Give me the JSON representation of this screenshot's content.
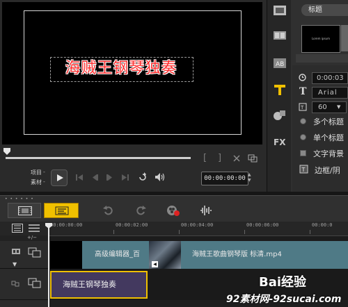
{
  "preview": {
    "title_overlay": "海贼王钢琴独奏",
    "project_label": "项目",
    "clip_label": "素材",
    "timecode": "00:00:00:00",
    "trim_brackets": [
      "[",
      "]"
    ]
  },
  "library": {
    "category": "标题",
    "thumb_caption": "Lorem ipsum",
    "sidebar_icons": [
      "media-icon",
      "transition-icon",
      "text-icon",
      "filter-icon",
      "fx-icon"
    ]
  },
  "options": {
    "duration": "0:00:03",
    "font": "Arial",
    "font_size": "60",
    "multi_title": "多个标题",
    "single_title": "单个标题",
    "text_background": "文字背景",
    "border_shadow": "边框/阴"
  },
  "toolbar": {
    "storyboard_icon": "film-icon",
    "timeline_icon": "timeline-icon"
  },
  "ruler": {
    "ticks": [
      "00:00:00:00",
      "00:00:02:00",
      "00:00:04:00",
      "00:00:06:00",
      "00:00:0"
    ]
  },
  "timeline": {
    "clip_1_label": "高级编辑器_百",
    "clip_2_label": "海贼王歌曲钢琴版 标清.mp4",
    "title_clip_label": "海贼王钢琴独奏"
  },
  "watermark": {
    "brand": "Bai经验",
    "site": "92素材网-92sucai.com"
  },
  "colors": {
    "accent": "#f0c000",
    "video_clip": "#4f7a86",
    "title_clip": "#43395f",
    "title_text": "#ff3030"
  }
}
